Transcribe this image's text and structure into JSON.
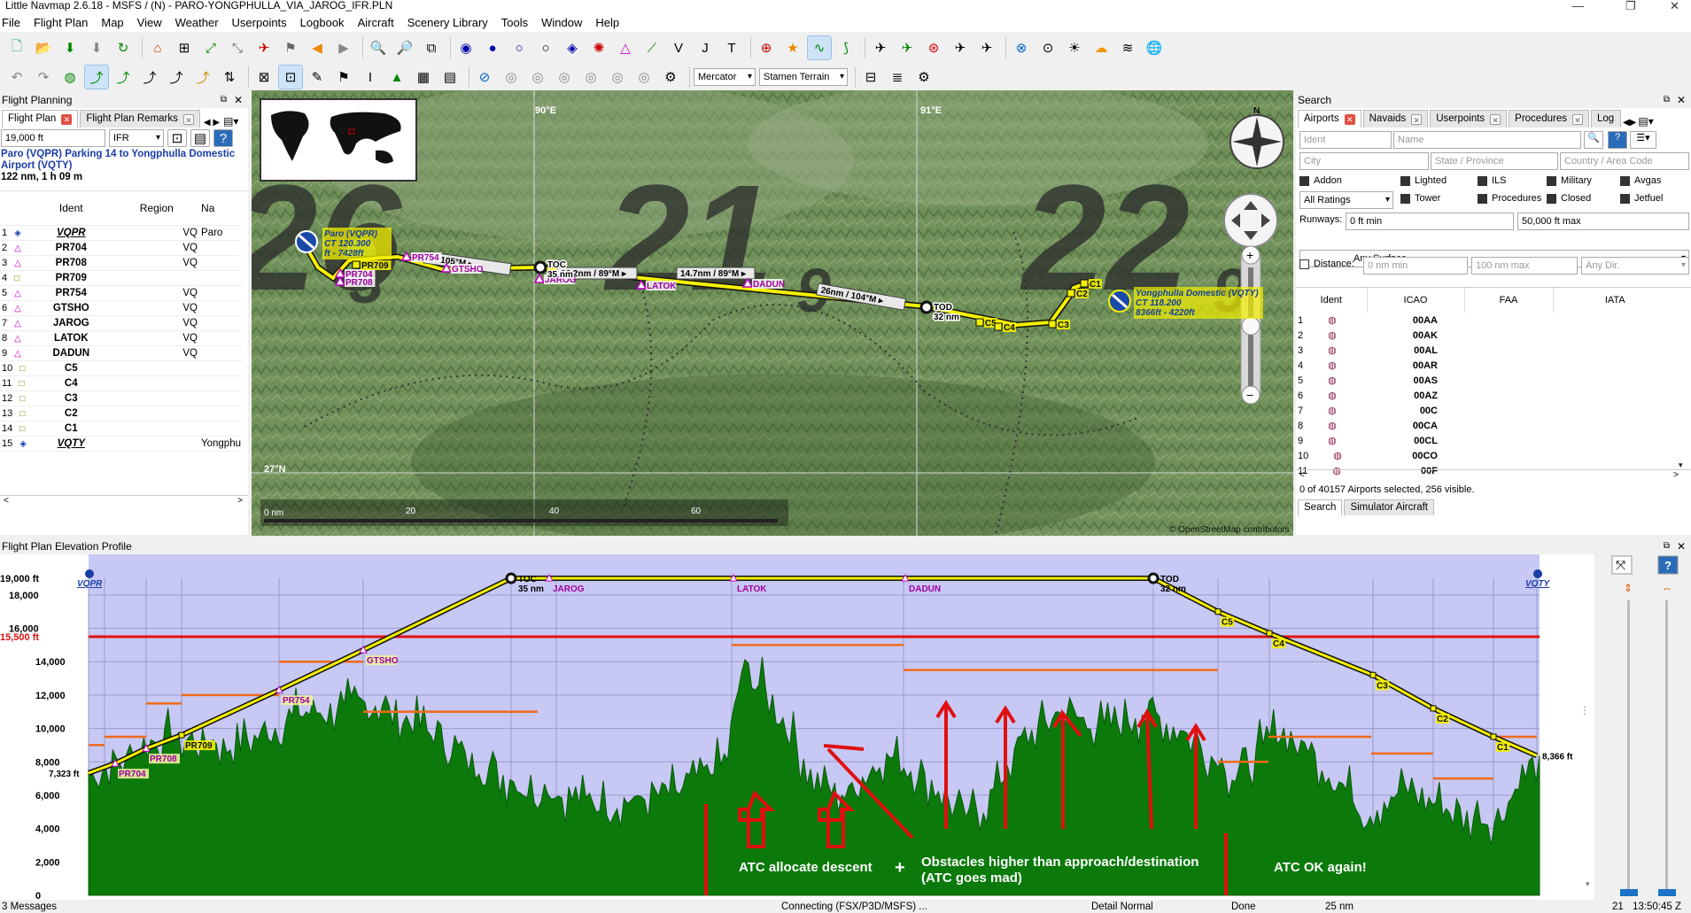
{
  "window": {
    "title": "Little Navmap 2.6.18 - MSFS / (N) - PARO-YONGPHULLA_VIA_JAROG_IFR.PLN"
  },
  "menu": [
    "File",
    "Flight Plan",
    "Map",
    "View",
    "Weather",
    "Userpoints",
    "Logbook",
    "Aircraft",
    "Scenery Library",
    "Tools",
    "Window",
    "Help"
  ],
  "toolbar2": {
    "projection": "Mercator",
    "theme": "Stamen Terrain"
  },
  "flight_planning": {
    "header": "Flight Planning",
    "tabs": [
      "Flight Plan",
      "Flight Plan Remarks"
    ],
    "altitude": "19,000 ft",
    "rule": "IFR",
    "route_line1": "Paro (VQPR) Parking 14 to Yongphulla Domestic",
    "route_line2": "Airport (VQTY)",
    "route_info": "122 nm, 1 h 09 m",
    "columns": [
      "Ident",
      "Region",
      "Na"
    ],
    "rows": [
      {
        "n": "1",
        "ident": "VQPR",
        "region": "VQ",
        "name": "Paro",
        "icon": "airport-icon"
      },
      {
        "n": "2",
        "ident": "PR704",
        "region": "VQ",
        "name": "",
        "icon": "waypoint-icon"
      },
      {
        "n": "3",
        "ident": "PR708",
        "region": "VQ",
        "name": "",
        "icon": "waypoint-icon"
      },
      {
        "n": "4",
        "ident": "PR709",
        "region": "",
        "name": "",
        "icon": "userpoint-icon"
      },
      {
        "n": "5",
        "ident": "PR754",
        "region": "VQ",
        "name": "",
        "icon": "waypoint-icon"
      },
      {
        "n": "6",
        "ident": "GTSHO",
        "region": "VQ",
        "name": "",
        "icon": "waypoint-icon"
      },
      {
        "n": "7",
        "ident": "JAROG",
        "region": "VQ",
        "name": "",
        "icon": "waypoint-icon"
      },
      {
        "n": "8",
        "ident": "LATOK",
        "region": "VQ",
        "name": "",
        "icon": "waypoint-icon"
      },
      {
        "n": "9",
        "ident": "DADUN",
        "region": "VQ",
        "name": "",
        "icon": "waypoint-icon"
      },
      {
        "n": "10",
        "ident": "C5",
        "region": "",
        "name": "",
        "icon": "userpoint-icon"
      },
      {
        "n": "11",
        "ident": "C4",
        "region": "",
        "name": "",
        "icon": "userpoint-icon"
      },
      {
        "n": "12",
        "ident": "C3",
        "region": "",
        "name": "",
        "icon": "userpoint-icon"
      },
      {
        "n": "13",
        "ident": "C2",
        "region": "",
        "name": "",
        "icon": "userpoint-icon"
      },
      {
        "n": "14",
        "ident": "C1",
        "region": "",
        "name": "",
        "icon": "userpoint-icon"
      },
      {
        "n": "15",
        "ident": "VQTY",
        "region": "",
        "name": "Yongphu",
        "icon": "airport-icon"
      }
    ]
  },
  "map": {
    "lon_labels": [
      "90°E",
      "91°E"
    ],
    "lat_label": "27°N",
    "grid_numbers": [
      "26",
      "3",
      "21",
      "9",
      "22",
      "9"
    ],
    "scale_labels": [
      "0 nm",
      "20",
      "40",
      "60"
    ],
    "attribution": "© OpenStreetMap contributors",
    "compass_letter": "N",
    "origin_label": [
      "Paro (VQPR)",
      "CT 120.300",
      "ft - 7428ft"
    ],
    "dest_label": [
      "Yongphulla Domestic (VQTY)",
      "CT 118.200",
      "8366ft - 4220ft"
    ],
    "leg_labels": [
      "n / 105°M ▸",
      "16.2nm / 89°M ▸",
      "14.7nm / 89°M ▸",
      "26nm / 104°M ▸"
    ],
    "waypoints": [
      "PR704",
      "PR708",
      "PR709",
      "PR754",
      "GTSHO",
      "JAROG",
      "LATOK",
      "DADUN",
      "C5",
      "C4",
      "C3",
      "C2",
      "C1"
    ],
    "toc": [
      "TOC",
      "35 nm"
    ],
    "tod": [
      "TOD",
      "32 nm"
    ]
  },
  "search": {
    "header": "Search",
    "tabs": [
      "Airports",
      "Navaids",
      "Userpoints",
      "Procedures",
      "Log"
    ],
    "ident_ph": "Ident",
    "name_ph": "Name",
    "city_ph": "City",
    "state_ph": "State / Province",
    "country_ph": "Country / Area Code",
    "checks": [
      "Addon",
      "Lighted",
      "ILS",
      "Military",
      "Avgas",
      "Tower",
      "Procedures",
      "Closed",
      "Jetfuel"
    ],
    "ratings": "All Ratings",
    "runways_label": "Runways:",
    "rw_min": "0 ft min",
    "rw_max": "50,000 ft max",
    "surface": "Any Surface",
    "distance_label": "Distance:",
    "dist_min": "0 nm min",
    "dist_max": "100 nm max",
    "dir": "Any Dir.",
    "columns": [
      "Ident",
      "ICAO",
      "FAA",
      "IATA"
    ],
    "rows": [
      [
        "1",
        "00AA"
      ],
      [
        "2",
        "00AK"
      ],
      [
        "3",
        "00AL"
      ],
      [
        "4",
        "00AR"
      ],
      [
        "5",
        "00AS"
      ],
      [
        "6",
        "00AZ"
      ],
      [
        "7",
        "00C"
      ],
      [
        "8",
        "00CA"
      ],
      [
        "9",
        "00CL"
      ],
      [
        "10",
        "00CO"
      ],
      [
        "11",
        "00F"
      ]
    ],
    "footer": "0 of 40157 Airports selected, 256 visible.",
    "bottom_tabs": [
      "Search",
      "Simulator Aircraft"
    ]
  },
  "profile": {
    "header": "Flight Plan Elevation Profile",
    "y_labels": [
      "19,000 ft",
      "18,000",
      "16,000",
      "15,500 ft",
      "14,000",
      "12,000",
      "10,000",
      "8,000",
      "6,000",
      "4,000",
      "2,000",
      "0"
    ],
    "start_alt": "7,323 ft",
    "end_alt": "8,366 ft",
    "points": [
      "VQPR",
      "PR704",
      "PR708",
      "PR709",
      "PR754",
      "GTSHO",
      "TOC",
      "35 nm",
      "JAROG",
      "LATOK",
      "DADUN",
      "TOD",
      "32 nm",
      "C5",
      "C4",
      "C3",
      "C2",
      "C1",
      "VQTY"
    ],
    "annotations": [
      "ATC allocate descent",
      "Obstacles higher than approach/destination",
      "(ATC goes mad)",
      "ATC OK again!"
    ]
  },
  "status": {
    "messages": "3 Messages",
    "connection": "Connecting (FSX/P3D/MSFS) ...",
    "detail": "Detail Normal",
    "done": "Done",
    "scale": "25 nm",
    "right": "21",
    "time": "13:50:45 Z"
  },
  "colors": {
    "route": "#f4f000",
    "terrain": "#0b7a0b",
    "sky": "#c8c8f4",
    "warning_line": "#e01010",
    "annotation": "#e01010"
  }
}
